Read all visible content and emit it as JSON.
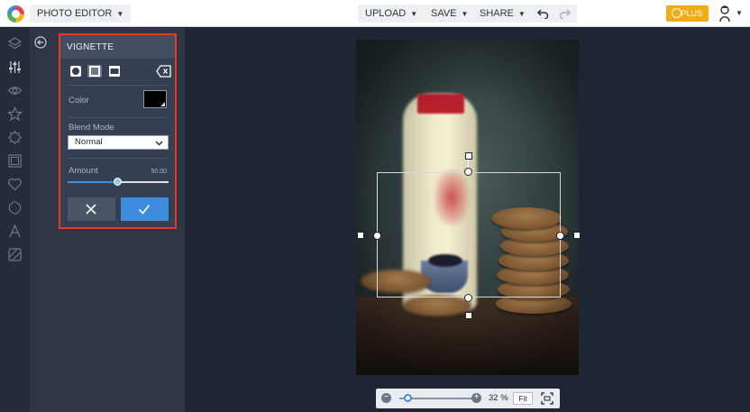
{
  "app": {
    "title_label": "PHOTO EDITOR",
    "plus_label": "PLUS"
  },
  "toolbar": {
    "upload_label": "UPLOAD",
    "save_label": "SAVE",
    "share_label": "SHARE"
  },
  "rail_icons": [
    "layers-icon",
    "adjustments-icon",
    "eye-icon",
    "star-icon",
    "sun-icon",
    "frame-icon",
    "heart-icon",
    "badge-icon",
    "text-icon",
    "texture-icon"
  ],
  "vignette": {
    "title": "VIGNETTE",
    "shapes": [
      "circle-shape",
      "rectangle-shape",
      "wide-shape"
    ],
    "active_shape": "rectangle-shape",
    "color_label": "Color",
    "color_value": "#000000",
    "blend_label": "Blend Mode",
    "blend_value": "Normal",
    "amount_label": "Amount",
    "amount_value": "50.00",
    "amount_fraction": 0.5
  },
  "zoom": {
    "percent": "32 %",
    "fit_label": "Fit",
    "level_fraction": 0.05
  },
  "colors": {
    "accent": "#3d8ce0",
    "highlight_border": "#e23a23",
    "plus": "#f2ac13"
  }
}
